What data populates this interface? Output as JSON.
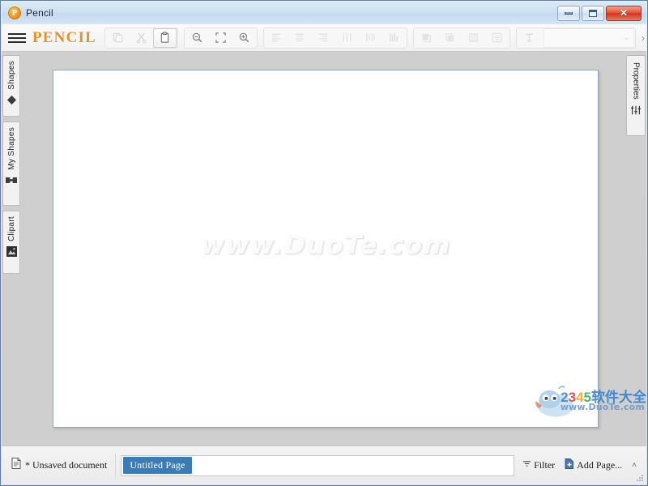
{
  "window": {
    "title": "Pencil",
    "app_icon": "pencil-app-icon",
    "icon_letter": "P",
    "controls": {
      "minimize": "minimize-button",
      "maximize": "maximize-button",
      "close_label": "✕"
    }
  },
  "toolbar": {
    "menu_icon": "hamburger-menu-icon",
    "brand": "PENCIL",
    "groups": [
      {
        "name": "clipboard",
        "buttons": [
          {
            "icon": "copy-icon",
            "label": "Copy",
            "disabled": true,
            "active": false
          },
          {
            "icon": "cut-icon",
            "label": "Cut",
            "disabled": true,
            "active": false
          },
          {
            "icon": "paste-icon",
            "label": "Paste",
            "disabled": false,
            "active": true
          }
        ]
      },
      {
        "name": "zoom",
        "buttons": [
          {
            "icon": "zoom-out-icon",
            "label": "Zoom Out",
            "disabled": false,
            "active": false
          },
          {
            "icon": "zoom-fit-icon",
            "label": "Zoom to Fit",
            "disabled": false,
            "active": false
          },
          {
            "icon": "zoom-in-icon",
            "label": "Zoom In",
            "disabled": false,
            "active": false
          }
        ]
      },
      {
        "name": "align",
        "buttons": [
          {
            "icon": "align-left-icon",
            "label": "Align Left",
            "disabled": true,
            "active": false
          },
          {
            "icon": "align-center-icon",
            "label": "Align Center",
            "disabled": true,
            "active": false
          },
          {
            "icon": "align-right-icon",
            "label": "Align Right",
            "disabled": true,
            "active": false
          },
          {
            "icon": "align-top-icon",
            "label": "Align Top",
            "disabled": true,
            "active": false
          },
          {
            "icon": "align-middle-icon",
            "label": "Align Middle",
            "disabled": true,
            "active": false
          },
          {
            "icon": "align-bottom-icon",
            "label": "Align Bottom",
            "disabled": true,
            "active": false
          }
        ]
      },
      {
        "name": "distribute",
        "buttons": [
          {
            "icon": "bring-to-front-icon",
            "label": "Bring to Front",
            "disabled": true,
            "active": false
          },
          {
            "icon": "send-to-back-icon",
            "label": "Send to Back",
            "disabled": true,
            "active": false
          },
          {
            "icon": "distribute-horizontal-icon",
            "label": "Distribute Horizontally",
            "disabled": true,
            "active": false
          },
          {
            "icon": "group-icon",
            "label": "Group",
            "disabled": true,
            "active": false
          }
        ]
      },
      {
        "name": "text",
        "buttons": [
          {
            "icon": "text-format-icon",
            "label": "Text",
            "disabled": true,
            "active": false
          }
        ]
      }
    ],
    "font_dropdown": {
      "value": " ",
      "placeholder": "",
      "arrow": "⌄"
    },
    "overflow_arrow": "›"
  },
  "sidebar_left": {
    "tabs": [
      {
        "label": "Shapes",
        "icon": "shapes-diamond-icon"
      },
      {
        "label": "My Shapes",
        "icon": "my-shapes-icon"
      },
      {
        "label": "Clipart",
        "icon": "clipart-image-icon"
      }
    ]
  },
  "sidebar_right": {
    "tabs": [
      {
        "label": "Properties",
        "icon": "sliders-properties-icon"
      }
    ]
  },
  "canvas": {
    "watermark": "www.DuoTe.com"
  },
  "watermark_badge": {
    "line1_parts": [
      {
        "text": "2",
        "color": "#2f7fd0"
      },
      {
        "text": "3",
        "color": "#e03a3a"
      },
      {
        "text": "4",
        "color": "#f0a31e"
      },
      {
        "text": "5",
        "color": "#3aaa55"
      },
      {
        "text": "软件大全",
        "color": "#2f7fd0"
      }
    ],
    "line2": "www.DuoTe.com",
    "mascot": "mascot-icon"
  },
  "statusbar": {
    "document_icon": "document-icon",
    "document_label": "* Unsaved document",
    "page_tab": "Untitled Page",
    "filter_icon": "filter-icon",
    "filter_label": "Filter",
    "add_page_icon": "add-page-icon",
    "add_page_label": "Add Page...",
    "collapse_arrow": "˄"
  },
  "colors": {
    "brand": "#e8912b",
    "page_tab_bg": "#3c7cb5",
    "titlebar_close": "#d2341d"
  }
}
